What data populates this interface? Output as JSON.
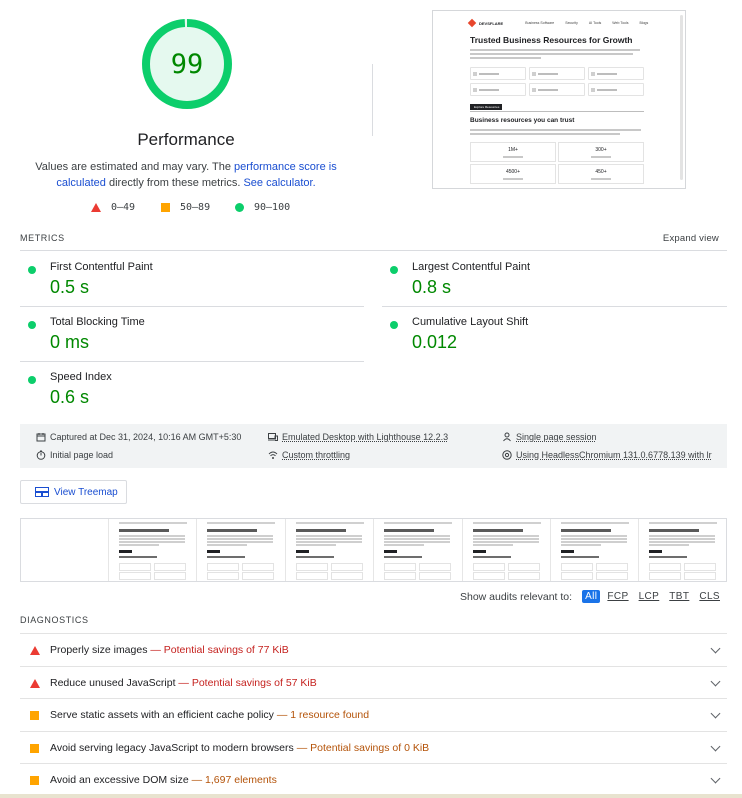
{
  "score": {
    "value": "99",
    "fraction": 0.99,
    "title": "Performance",
    "desc_prefix": "Values are estimated and may vary. The ",
    "desc_link1": "performance score is calculated",
    "desc_middle": " directly from these metrics. ",
    "desc_link2": "See calculator.",
    "colors": {
      "pass": "#0cce6b",
      "pass_text": "#008800",
      "average": "#ffa400",
      "fail": "#eb3b33",
      "gauge_bg": "#e5f9ef"
    }
  },
  "legend": [
    {
      "icon": "triangle-fail-icon",
      "range": "0–49"
    },
    {
      "icon": "square-average-icon",
      "range": "50–89"
    },
    {
      "icon": "circle-pass-icon",
      "range": "90–100"
    }
  ],
  "thumbnail": {
    "brand": "DEVSFLARE",
    "nav": [
      "Business Software",
      "Security",
      "AI Tools",
      "Web Tools",
      "Blogs"
    ],
    "heading": "Trusted Business Resources for Growth",
    "button": "Explore Resources",
    "subheading": "Business resources you can trust",
    "stats": [
      "1M+",
      "300+",
      "4500+",
      "450+"
    ]
  },
  "metrics": {
    "label": "METRICS",
    "expand": "Expand view",
    "items": [
      {
        "title": "First Contentful Paint",
        "value": "0.5 s"
      },
      {
        "title": "Largest Contentful Paint",
        "value": "0.8 s"
      },
      {
        "title": "Total Blocking Time",
        "value": "0 ms"
      },
      {
        "title": "Cumulative Layout Shift",
        "value": "0.012"
      },
      {
        "title": "Speed Index",
        "value": "0.6 s"
      }
    ]
  },
  "runtime": {
    "captured": "Captured at Dec 31, 2024, 10:16 AM GMT+5:30",
    "initial_load": "Initial page load",
    "emulated": "Emulated Desktop with Lighthouse 12.2.3",
    "throttling": "Custom throttling",
    "session": "Single page session",
    "browser": "Using HeadlessChromium 131.0.6778.139 with lr"
  },
  "treemap": {
    "label": "View Treemap"
  },
  "audit_filter": {
    "label": "Show audits relevant to:",
    "options": [
      "All",
      "FCP",
      "LCP",
      "TBT",
      "CLS"
    ],
    "active": "All"
  },
  "diagnostics": {
    "label": "DIAGNOSTICS",
    "items": [
      {
        "severity": "fail",
        "title": "Properly size images",
        "detail": "Potential savings of 77 KiB"
      },
      {
        "severity": "fail",
        "title": "Reduce unused JavaScript",
        "detail": "Potential savings of 57 KiB"
      },
      {
        "severity": "average",
        "title": "Serve static assets with an efficient cache policy",
        "detail": "1 resource found"
      },
      {
        "severity": "average",
        "title": "Avoid serving legacy JavaScript to modern browsers",
        "detail": "Potential savings of 0 KiB"
      },
      {
        "severity": "average",
        "title": "Avoid an excessive DOM size",
        "detail": "1,697 elements"
      }
    ]
  }
}
